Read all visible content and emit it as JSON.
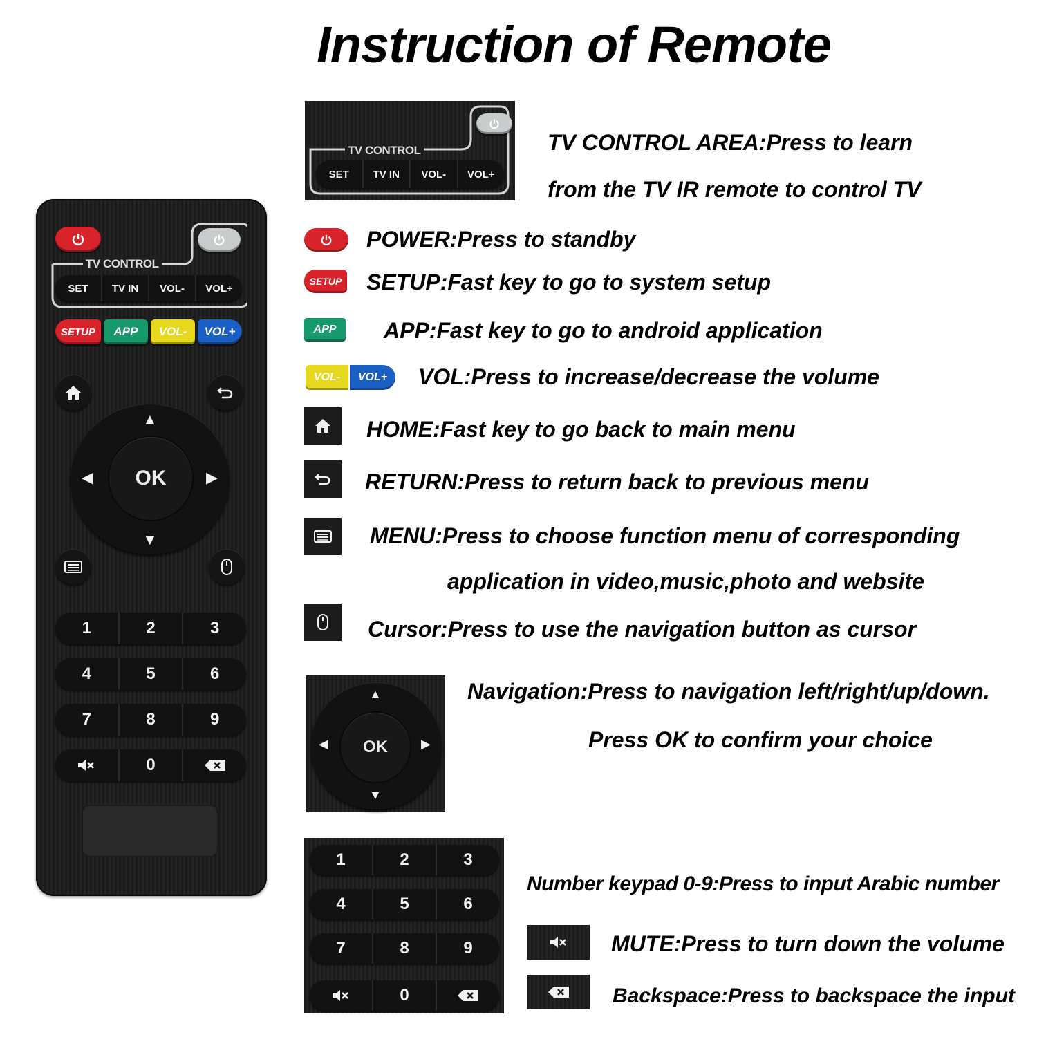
{
  "title": "Instruction of Remote",
  "remote": {
    "tv_control_label": "TV CONTROL",
    "tv_buttons": [
      "SET",
      "TV IN",
      "VOL-",
      "VOL+"
    ],
    "color_buttons": {
      "setup": "SETUP",
      "app": "APP",
      "vol_minus": "VOL-",
      "vol_plus": "VOL+"
    },
    "ok_label": "OK",
    "keypad": [
      [
        "1",
        "2",
        "3"
      ],
      [
        "4",
        "5",
        "6"
      ],
      [
        "7",
        "8",
        "9"
      ],
      [
        "mute",
        "0",
        "backspace"
      ]
    ]
  },
  "callouts": {
    "tv_control": {
      "line1": "TV CONTROL AREA:Press to learn",
      "line2": "from the TV IR remote to control TV"
    },
    "power": "POWER:Press to standby",
    "setup": "SETUP:Fast key to go to system setup",
    "app": "APP:Fast key to go to android application",
    "vol": "VOL:Press to increase/decrease the volume",
    "home": "HOME:Fast key to go back to main menu",
    "return": "RETURN:Press to return back to previous menu",
    "menu": {
      "line1": "MENU:Press to choose function menu of corresponding",
      "line2": "application in video,music,photo and website"
    },
    "cursor": "Cursor:Press to use the navigation button as cursor",
    "navigation": {
      "line1": "Navigation:Press to navigation left/right/up/down.",
      "line2": "Press OK to confirm your choice"
    },
    "keypad": "Number keypad 0-9:Press to input Arabic number",
    "mute": "MUTE:Press to turn down the volume",
    "backspace": "Backspace:Press to backspace the input"
  },
  "colors": {
    "red": "#d8232a",
    "green": "#179a6b",
    "yellow": "#e6d81d",
    "blue": "#1a5fc4",
    "grey": "#c8cccd",
    "body": "#1f1f1f"
  }
}
